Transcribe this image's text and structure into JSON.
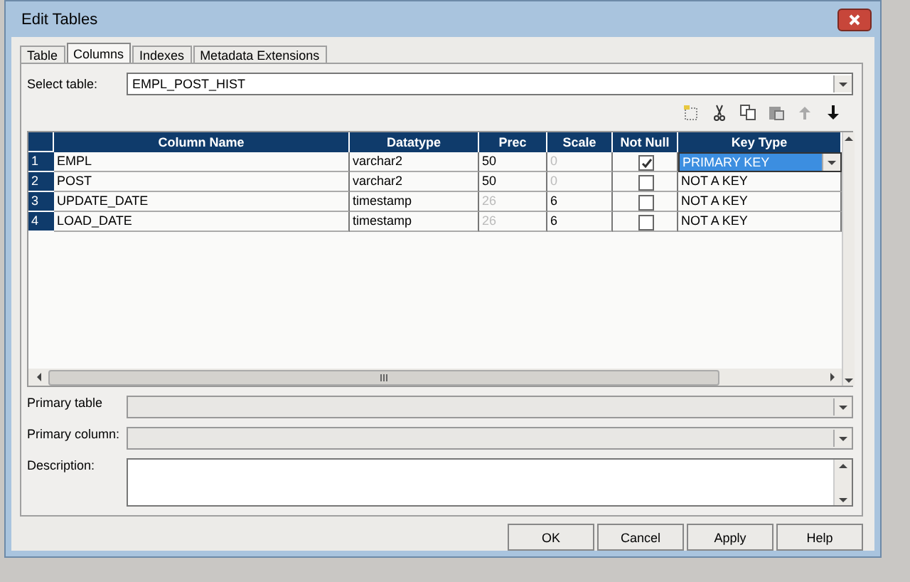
{
  "window": {
    "title": "Edit Tables"
  },
  "tabs": [
    {
      "label": "Table",
      "selected": false
    },
    {
      "label": "Columns",
      "selected": true
    },
    {
      "label": "Indexes",
      "selected": false
    },
    {
      "label": "Metadata Extensions",
      "selected": false
    }
  ],
  "select_table": {
    "label": "Select table:",
    "value": "EMPL_POST_HIST"
  },
  "table": {
    "columns": [
      "Column Name",
      "Datatype",
      "Prec",
      "Scale",
      "Not Null",
      "Key Type"
    ],
    "rows": [
      {
        "number": "1",
        "name": "EMPL",
        "datatype": "varchar2",
        "prec": {
          "text": "50",
          "disabled": false
        },
        "scale": {
          "text": "0",
          "disabled": true
        },
        "not_null": true,
        "key_type": "PRIMARY KEY",
        "selected": true
      },
      {
        "number": "2",
        "name": "POST",
        "datatype": "varchar2",
        "prec": {
          "text": "50",
          "disabled": false
        },
        "scale": {
          "text": "0",
          "disabled": true
        },
        "not_null": false,
        "key_type": "NOT A KEY",
        "selected": false
      },
      {
        "number": "3",
        "name": "UPDATE_DATE",
        "datatype": "timestamp",
        "prec": {
          "text": "26",
          "disabled": true
        },
        "scale": {
          "text": "6",
          "disabled": false
        },
        "not_null": false,
        "key_type": "NOT A KEY",
        "selected": false
      },
      {
        "number": "4",
        "name": "LOAD_DATE",
        "datatype": "timestamp",
        "prec": {
          "text": "26",
          "disabled": true
        },
        "scale": {
          "text": "6",
          "disabled": false
        },
        "not_null": false,
        "key_type": "NOT A KEY",
        "selected": false
      }
    ]
  },
  "fields": [
    {
      "label": "Primary table",
      "kind": "dropdown"
    },
    {
      "label": "Primary column:",
      "kind": "dropdown"
    },
    {
      "label": "Description:",
      "kind": "textarea"
    }
  ],
  "buttons": [
    "OK",
    "Cancel",
    "Apply",
    "Help"
  ]
}
